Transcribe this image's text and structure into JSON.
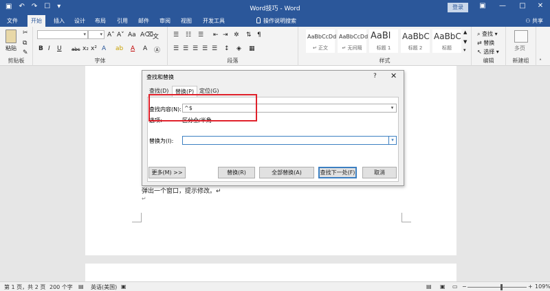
{
  "titlebar": {
    "title": "Word技巧 - Word",
    "login": "登录",
    "minimize": "—",
    "restore": "□",
    "close": "✕",
    "qa_icons": [
      "save-icon",
      "undo-icon",
      "redo-icon",
      "touch-mode-icon",
      "customize-icon"
    ]
  },
  "tabs": {
    "file": "文件",
    "home": "开始",
    "insert": "插入",
    "design": "设计",
    "layout": "布局",
    "references": "引用",
    "mailings": "邮件",
    "review": "审阅",
    "view": "视图",
    "developer": "开发工具",
    "tell_me": "操作说明搜索",
    "share": "共享"
  },
  "ribbon": {
    "clipboard": {
      "paste": "粘贴",
      "label": "剪贴板"
    },
    "font": {
      "label": "字体",
      "bold": "B",
      "italic": "I",
      "underline": "U",
      "strike": "abc",
      "sub": "x₂",
      "sup": "x²",
      "color_a": "A"
    },
    "paragraph": {
      "label": "段落"
    },
    "styles": {
      "label": "样式",
      "items": [
        {
          "sample": "AaBbCcDd",
          "name": "↵ 正文"
        },
        {
          "sample": "AaBbCcDd",
          "name": "↵ 无间隔"
        },
        {
          "sample": "AaBl",
          "name": "标题 1"
        },
        {
          "sample": "AaBbC",
          "name": "标题 2"
        },
        {
          "sample": "AaBbC",
          "name": "标题"
        }
      ]
    },
    "editing": {
      "label": "编辑",
      "find": "查找",
      "replace": "替换",
      "select": "选择"
    },
    "new_group": {
      "label": "新建组",
      "pages": "多页"
    }
  },
  "document": {
    "text": "弹出一个窗口，提示修改。↵",
    "pilcrow": "↵"
  },
  "statusbar": {
    "page": "第 1 页，共 2 页",
    "words": "200 个字",
    "language": "英语(美国)",
    "zoom": "109%",
    "zoom_level": 0.55
  },
  "dialog": {
    "title": "查找和替换",
    "help": "?",
    "close": "✕",
    "tabs": [
      "查找(D)",
      "替换(P)",
      "定位(G)"
    ],
    "active_tab": 1,
    "find_label": "查找内容(N):",
    "find_value": "^$",
    "options_label": "选项:",
    "options_value": "区分全/半角",
    "replace_label": "替换为(I):",
    "replace_value": "",
    "buttons": {
      "more": "更多(M) >>",
      "replace": "替换(R)",
      "replace_all": "全部替换(A)",
      "find_next": "查找下一处(F)",
      "cancel": "取消"
    }
  },
  "accent": {
    "brand": "#2b579a",
    "highlight": "#e0202a"
  }
}
